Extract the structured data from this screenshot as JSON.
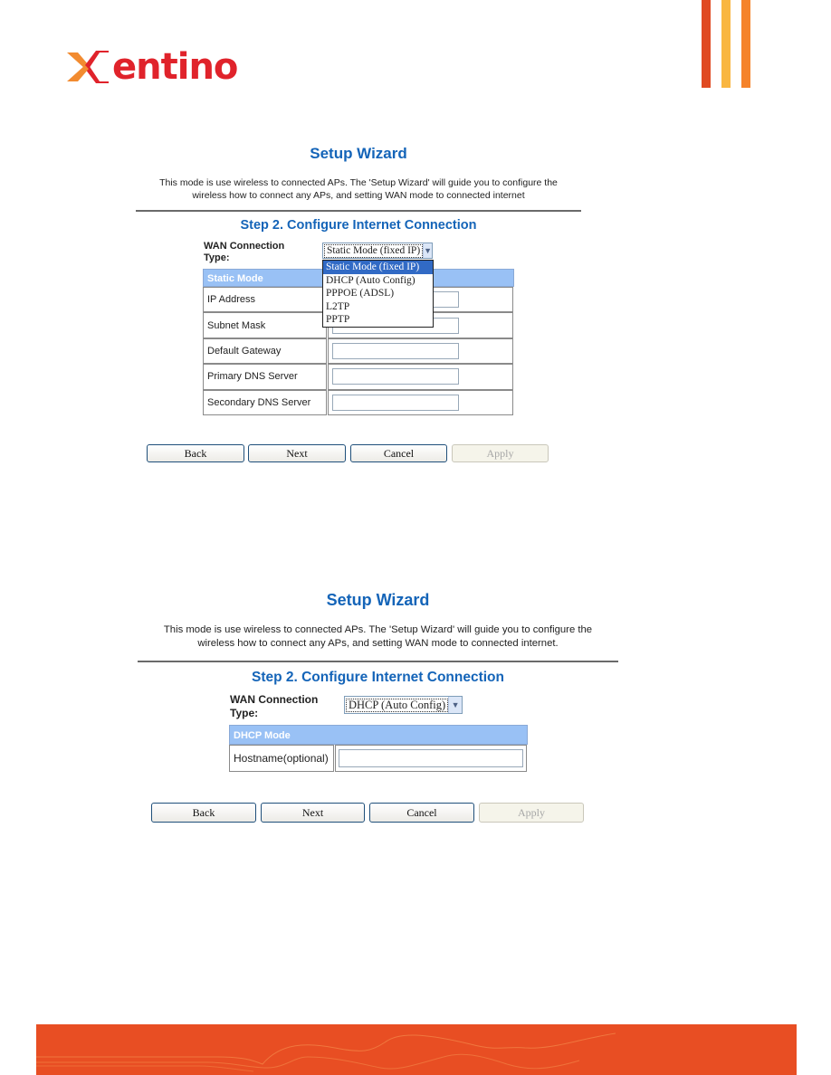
{
  "brand": {
    "logo_text": "entino",
    "logo_mark": "X",
    "colors": {
      "logo_red": "#e0232b",
      "logo_orange": "#f28b30",
      "accent_blue": "#1464b8",
      "footer": "#e84e23",
      "table_header": "#99c1f5",
      "selected_option": "#316ac5"
    }
  },
  "panel1": {
    "title": "Setup Wizard",
    "description_line1": "This mode is use wireless to connected APs. The 'Setup Wizard' will guide you to configure the",
    "description_line2": "wireless how to connect any APs, and setting WAN mode to connected internet",
    "step_title": "Step 2. Configure Internet Connection",
    "wan_label_line1": "WAN Connection",
    "wan_label_line2": "Type:",
    "wan_selected": "Static Mode (fixed IP)",
    "dropdown_options": [
      "Static Mode (fixed IP)",
      "DHCP (Auto Config)",
      "PPPOE (ADSL)",
      "L2TP",
      "PPTP"
    ],
    "dropdown_open": true,
    "mode_header": "Static Mode",
    "fields": [
      {
        "label": "IP Address",
        "value": ""
      },
      {
        "label": "Subnet Mask",
        "value": ""
      },
      {
        "label": "Default Gateway",
        "value": ""
      },
      {
        "label": "Primary DNS Server",
        "value": ""
      },
      {
        "label": "Secondary DNS Server",
        "value": ""
      }
    ],
    "buttons": {
      "back": "Back",
      "next": "Next",
      "cancel": "Cancel",
      "apply": "Apply"
    }
  },
  "panel2": {
    "title": "Setup Wizard",
    "description_line1": "This mode is use wireless to connected APs. The 'Setup Wizard' will guide you to configure the",
    "description_line2": "wireless how to connect any APs, and setting WAN mode to connected internet.",
    "step_title": "Step 2. Configure Internet Connection",
    "wan_label_line1": "WAN Connection",
    "wan_label_line2": "Type:",
    "wan_selected": "DHCP (Auto Config)",
    "mode_header": "DHCP Mode",
    "fields": [
      {
        "label": "Hostname(optional)",
        "value": ""
      }
    ],
    "buttons": {
      "back": "Back",
      "next": "Next",
      "cancel": "Cancel",
      "apply": "Apply"
    }
  }
}
